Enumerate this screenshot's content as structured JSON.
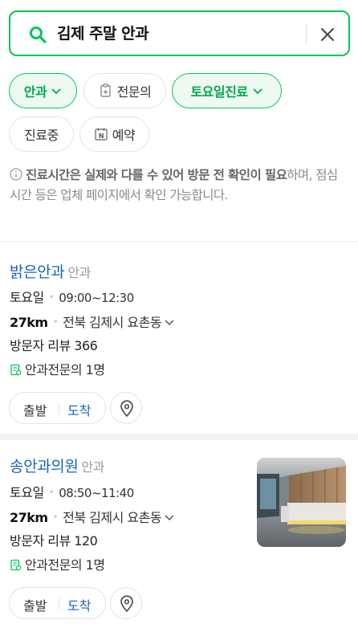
{
  "search": {
    "query": "김제 주말 안과"
  },
  "filters": [
    {
      "label": "안과",
      "active": true,
      "has_dropdown": true
    },
    {
      "label": "전문의",
      "active": false,
      "icon": "specialist-doc-icon"
    },
    {
      "label": "토요일진료",
      "active": true,
      "has_dropdown": true
    },
    {
      "label": "진료중",
      "active": false
    },
    {
      "label": "예약",
      "active": false,
      "icon": "naver-booking-icon"
    }
  ],
  "notice": {
    "bold": "진료시간은 실제와 다를 수 있어 방문 전 확인이 필요",
    "rest": "하며, 점심시간 등은 업체 페이지에서 확인 가능합니다."
  },
  "places": [
    {
      "name": "밝은안과",
      "category": "안과",
      "day": "토요일",
      "hours": "09:00~12:30",
      "distance": "27km",
      "address": "전북 김제시 요촌동",
      "reviews": "방문자 리뷰 366",
      "specialist": "안과전문의 1명",
      "start_label": "출발",
      "arrive_label": "도착",
      "has_photo": false
    },
    {
      "name": "송안과의원",
      "category": "안과",
      "day": "토요일",
      "hours": "08:50~11:40",
      "distance": "27km",
      "address": "전북 김제시 요촌동",
      "reviews": "방문자 리뷰 120",
      "specialist": "안과전문의 1명",
      "start_label": "출발",
      "arrive_label": "도착",
      "has_photo": true
    }
  ],
  "colors": {
    "accent": "#03c75a",
    "link": "#1764b8",
    "active_chip_bg": "#edf9f1"
  }
}
